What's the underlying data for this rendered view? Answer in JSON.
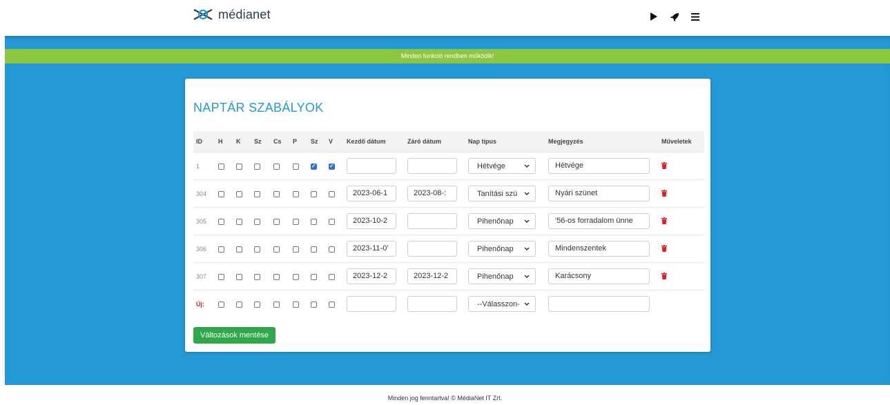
{
  "brand": {
    "name": "médianet"
  },
  "nav_icons": [
    "play-icon",
    "rocket-icon",
    "menu-icon"
  ],
  "alert": {
    "text": "Minden funkció rendben működik!"
  },
  "page": {
    "title": "NAPTÁR SZABÁLYOK"
  },
  "table": {
    "headers": [
      "ID",
      "H",
      "K",
      "Sz",
      "Cs",
      "P",
      "Sz",
      "V",
      "Kezdő dátum",
      "Záró dátum",
      "Nap típus",
      "Megjegyzés",
      "Műveletek"
    ],
    "rows": [
      {
        "id": "1",
        "days": [
          false,
          false,
          false,
          false,
          false,
          true,
          true
        ],
        "start": "",
        "end": "",
        "type": "Hétvége",
        "note": "Hétvége"
      },
      {
        "id": "304",
        "days": [
          false,
          false,
          false,
          false,
          false,
          false,
          false
        ],
        "start": "2023-06-1",
        "end": "2023-08-:",
        "type": "Tanítási szü",
        "note": "Nyári szünet"
      },
      {
        "id": "305",
        "days": [
          false,
          false,
          false,
          false,
          false,
          false,
          false
        ],
        "start": "2023-10-2",
        "end": "",
        "type": "Pihenőnap",
        "note": "'56-os forradalom ünne"
      },
      {
        "id": "306",
        "days": [
          false,
          false,
          false,
          false,
          false,
          false,
          false
        ],
        "start": "2023-11-0'",
        "end": "",
        "type": "Pihenőnap",
        "note": "Mindenszentek"
      },
      {
        "id": "307",
        "days": [
          false,
          false,
          false,
          false,
          false,
          false,
          false
        ],
        "start": "2023-12-2",
        "end": "2023-12-2",
        "type": "Pihenőnap",
        "note": "Karácsony"
      }
    ],
    "new_row": {
      "label": "Új:",
      "type_placeholder": "--Válasszon-"
    }
  },
  "save_button": {
    "label": "Változások mentése"
  },
  "footer": {
    "text": "Minden jog fenntartva! © MédiaNet IT Zrt."
  },
  "colors": {
    "primary": "#2499d6",
    "alert": "#8dc63f",
    "save": "#2fa74a",
    "delete": "#e02020"
  }
}
